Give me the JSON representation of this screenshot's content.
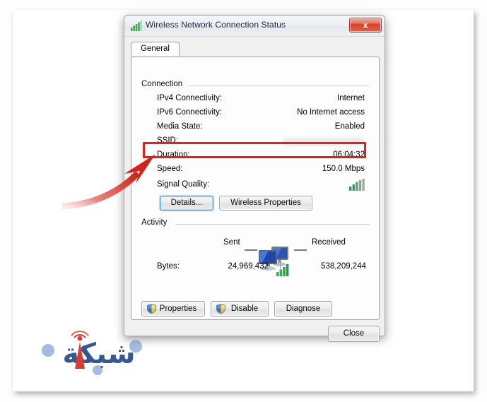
{
  "window": {
    "title": "Wireless Network Connection Status",
    "icon": "signal-bars-icon",
    "close_label": "x"
  },
  "tabs": [
    {
      "label": "General",
      "selected": true
    }
  ],
  "connection": {
    "group_label": "Connection",
    "rows": [
      {
        "label": "IPv4 Connectivity:",
        "value": "Internet"
      },
      {
        "label": "IPv6 Connectivity:",
        "value": "No Internet access"
      },
      {
        "label": "Media State:",
        "value": "Enabled"
      },
      {
        "label": "SSID:",
        "value": "",
        "redacted": true
      },
      {
        "label": "Duration:",
        "value": "06:04:32"
      },
      {
        "label": "Speed:",
        "value": "150.0 Mbps",
        "highlighted": true
      },
      {
        "label": "Signal Quality:",
        "value": "",
        "signal_bars": 3,
        "signal_total": 5
      }
    ],
    "buttons": [
      {
        "label": "Details...",
        "focused": true
      },
      {
        "label": "Wireless Properties",
        "focused": false
      }
    ]
  },
  "activity": {
    "group_label": "Activity",
    "sent_label": "Sent",
    "received_label": "Received",
    "center_icon": "two-computers-icon",
    "bytes_label": "Bytes:",
    "bytes_sent": "24,969,432",
    "bytes_received": "538,209,244"
  },
  "action_buttons": [
    {
      "label": "Properties",
      "shield": true
    },
    {
      "label": "Disable",
      "shield": true
    },
    {
      "label": "Diagnose",
      "shield": false
    }
  ],
  "footer": {
    "close_label": "Close"
  },
  "annotation": {
    "highlight_color": "#ee1c16",
    "arrow_color": "#d92b22",
    "target": "Speed:"
  },
  "watermark": {
    "text": "شبكة",
    "icon": "antenna-tower-icon"
  }
}
